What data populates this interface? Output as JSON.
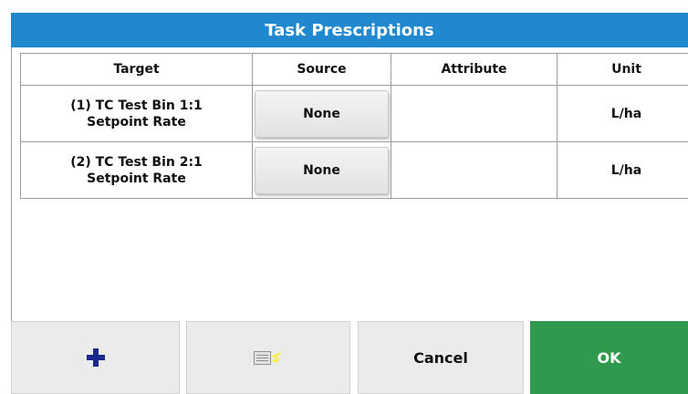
{
  "title": "Task Prescriptions",
  "table": {
    "headers": [
      "Target",
      "Source",
      "Attribute",
      "Unit"
    ],
    "rows": [
      {
        "target_line1": "(1) TC Test Bin 1:1",
        "target_line2": "Setpoint Rate",
        "source": "None",
        "attribute": "",
        "unit": "L/ha"
      },
      {
        "target_line1": "(2) TC Test Bin 2:1",
        "target_line2": "Setpoint Rate",
        "source": "None",
        "attribute": "",
        "unit": "L/ha"
      }
    ]
  },
  "buttons": {
    "add_icon": "plus-icon",
    "list_icon": "list-icon",
    "cancel": "Cancel",
    "ok": "OK"
  },
  "colors": {
    "title_bar": "#1f88cf",
    "ok_button": "#2f9a4d",
    "add_icon": "#1a2a8c"
  }
}
